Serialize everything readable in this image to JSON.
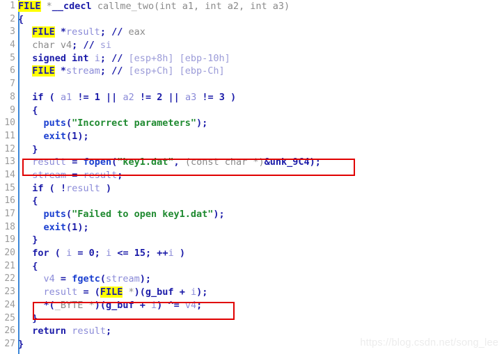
{
  "editor": {
    "kind": "decompiler-pseudocode-view",
    "background_color": "#ffffff",
    "gutter_rule_color": "#3a86d8",
    "line_number_color": "#9a9a9a",
    "highlight_color": "#ffff00",
    "annotation_box_color": "#e00000",
    "keyword_color": "#1a1aa8",
    "function_color": "#1a3fd0",
    "variable_color": "#8b8bd8",
    "string_color": "#1f8a30",
    "comment_color": "#9b9bd8",
    "plain_color": "#8a8a8a",
    "line_numbers": [
      "1",
      "2",
      "3",
      "4",
      "5",
      "6",
      "7",
      "8",
      "9",
      "10",
      "11",
      "12",
      "13",
      "14",
      "15",
      "16",
      "17",
      "18",
      "19",
      "20",
      "21",
      "22",
      "23",
      "24",
      "25",
      "26",
      "27"
    ],
    "lines_plaintext": [
      "FILE *__cdecl callme_two(int a1, int a2, int a3)",
      "{",
      "  FILE *result; // eax",
      "  char v4; // si",
      "  signed int i; // [esp+8h] [ebp-10h]",
      "  FILE *stream; // [esp+Ch] [ebp-Ch]",
      "",
      "  if ( a1 != 1 || a2 != 2 || a3 != 3 )",
      "  {",
      "    puts(\"Incorrect parameters\");",
      "    exit(1);",
      "  }",
      "  result = fopen(\"key1.dat\", (const char *)&unk_9C4);",
      "  stream = result;",
      "  if ( !result )",
      "  {",
      "    puts(\"Failed to open key1.dat\");",
      "    exit(1);",
      "  }",
      "  for ( i = 0; i <= 15; ++i )",
      "  {",
      "    v4 = fgetc(stream);",
      "    result = (FILE *)(g_buf + i);",
      "    *(_BYTE *)(g_buf + i) ^= v4;",
      "  }",
      "  return result;",
      "}"
    ]
  },
  "annotations": [
    {
      "name": "fopen-call-highlight",
      "line": 13,
      "text": "result = fopen(\"key1.dat\", (const char *)&unk_9C4);"
    },
    {
      "name": "xor-loop-highlight",
      "line": 24,
      "text": "*(_BYTE *)(g_buf + i) ^= v4;"
    }
  ],
  "highlighted_tokens": [
    {
      "line": 1,
      "token": "FILE"
    },
    {
      "line": 3,
      "token": "FILE"
    },
    {
      "line": 6,
      "token": "FILE"
    },
    {
      "line": 23,
      "token": "FILE"
    }
  ],
  "watermark": {
    "text": "https://blog.csdn.net/song_lee"
  }
}
